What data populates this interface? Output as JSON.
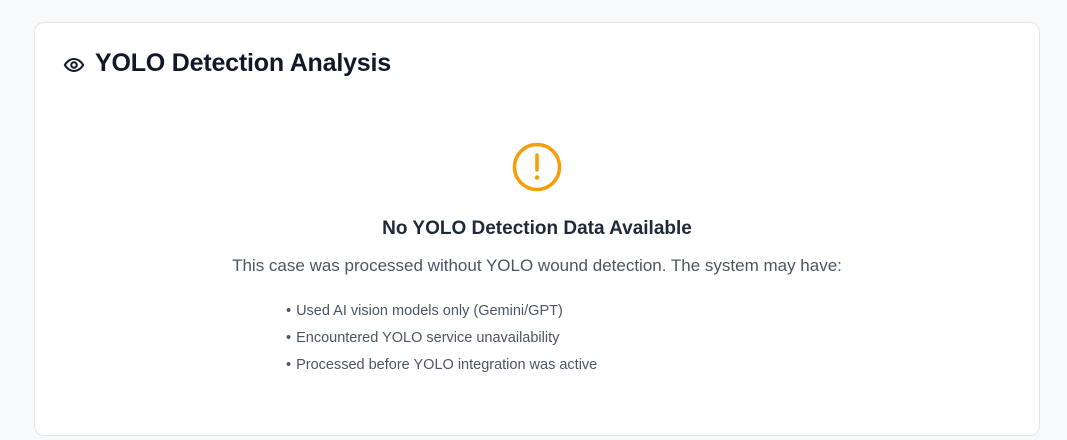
{
  "card": {
    "title": "YOLO Detection Analysis",
    "title_icon": "eye-icon"
  },
  "empty_state": {
    "icon": "alert-circle-icon",
    "icon_color": "#f59e0b",
    "title": "No YOLO Detection Data Available",
    "description": "This case was processed without YOLO wound detection. The system may have:",
    "bullet": "•",
    "reasons": [
      "Used AI vision models only (Gemini/GPT)",
      "Encountered YOLO service unavailability",
      "Processed before YOLO integration was active"
    ]
  }
}
